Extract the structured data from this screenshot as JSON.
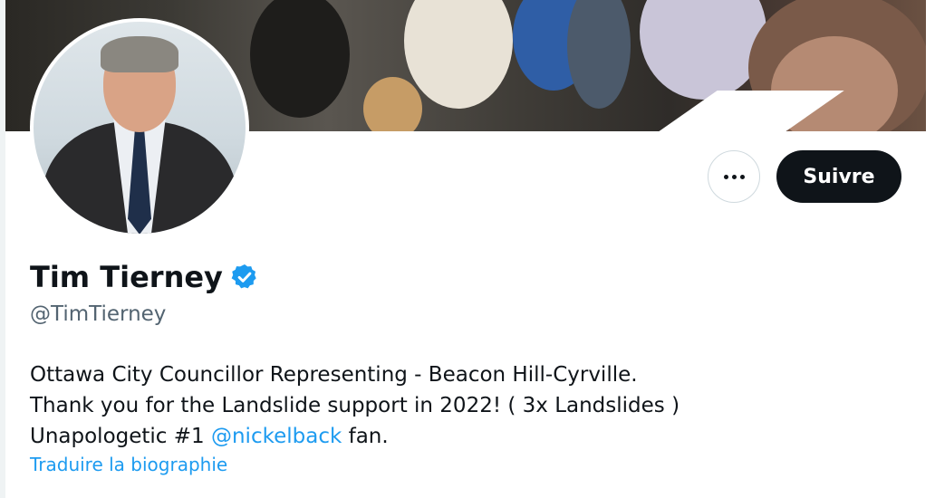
{
  "profile": {
    "name": "Tim Tierney",
    "handle": "@TimTierney",
    "verified": true,
    "bio": {
      "line1": "Ottawa City Councillor Representing - Beacon Hill-Cyrville.",
      "line2": "Thank you for the Landslide support in 2022! ( 3x Landslides )",
      "line3_prefix": "Unapologetic #1 ",
      "line3_link": "@nickelback",
      "line3_suffix": " fan."
    },
    "translate_label": "Traduire la biographie"
  },
  "actions": {
    "more_icon": "more-horizontal-icon",
    "follow_label": "Suivre"
  },
  "colors": {
    "accent": "#1d9bf0",
    "text": "#0f1419",
    "secondary_text": "#536471",
    "button_dark": "#0f1419"
  }
}
